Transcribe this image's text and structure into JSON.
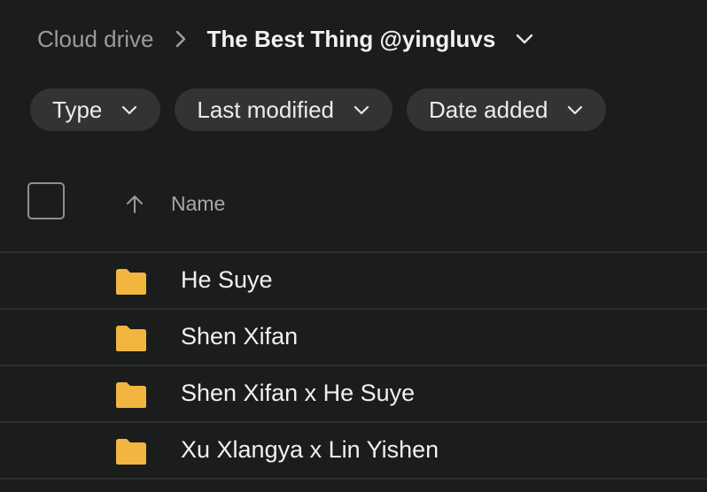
{
  "breadcrumb": {
    "parent": "Cloud drive",
    "current": "The Best Thing @yingluvs"
  },
  "filters": [
    {
      "label": "Type"
    },
    {
      "label": "Last modified"
    },
    {
      "label": "Date added"
    }
  ],
  "list_header": {
    "name_label": "Name"
  },
  "folders": [
    {
      "name": "He Suye"
    },
    {
      "name": "Shen Xifan"
    },
    {
      "name": "Shen Xifan x He Suye"
    },
    {
      "name": "Xu Xlangya x Lin Yishen"
    }
  ],
  "colors": {
    "background": "#1b1c1c",
    "chip": "#323434",
    "folder": "#f2b53f"
  },
  "icons": {
    "separator": "chevron-right-icon",
    "dropdown": "chevron-down-icon",
    "sort": "arrow-up-icon",
    "folder": "folder-icon"
  }
}
